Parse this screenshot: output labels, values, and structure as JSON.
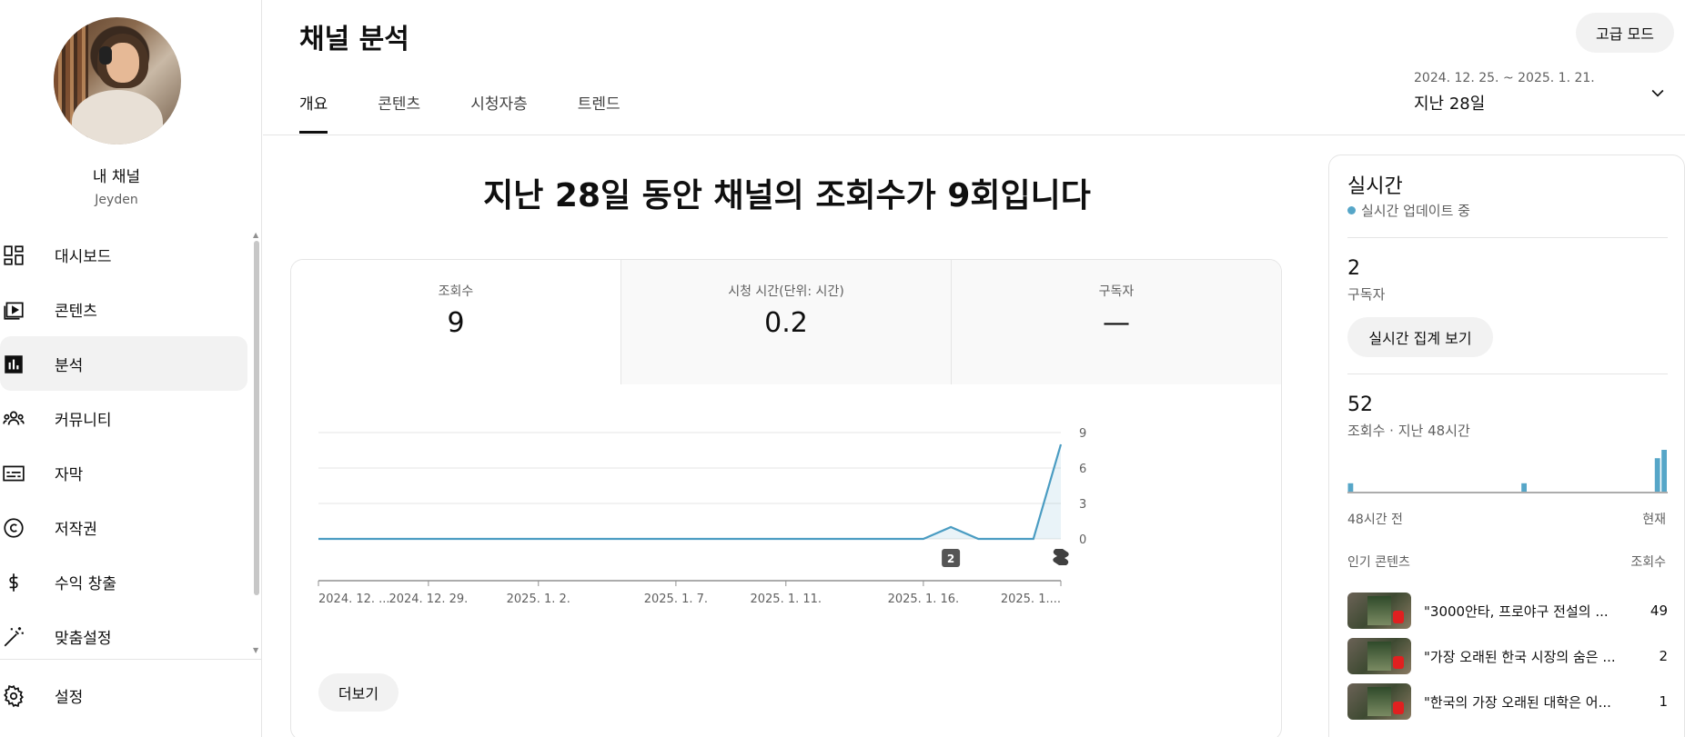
{
  "sidebar": {
    "channel_name": "내 채널",
    "channel_handle": "Jeyden",
    "items": [
      {
        "label": "대시보드",
        "icon": "dashboard-icon"
      },
      {
        "label": "콘텐츠",
        "icon": "content-icon"
      },
      {
        "label": "분석",
        "icon": "analytics-icon"
      },
      {
        "label": "커뮤니티",
        "icon": "community-icon"
      },
      {
        "label": "자막",
        "icon": "subtitles-icon"
      },
      {
        "label": "저작권",
        "icon": "copyright-icon"
      },
      {
        "label": "수익 창출",
        "icon": "monetization-icon"
      },
      {
        "label": "맞춤설정",
        "icon": "customization-icon"
      }
    ],
    "settings_label": "설정",
    "active_item": "분석"
  },
  "header": {
    "title": "채널 분석",
    "advanced_mode": "고급 모드",
    "tabs": [
      "개요",
      "콘텐츠",
      "시청자층",
      "트렌드"
    ],
    "active_tab": "개요",
    "date_range": "2024. 12. 25. ~ 2025. 1. 21.",
    "date_label": "지난 28일"
  },
  "main": {
    "headline": "지난 28일 동안 채널의 조회수가 9회입니다",
    "metrics": [
      {
        "label": "조회수",
        "value": "9"
      },
      {
        "label": "시청 시간(단위: 시간)",
        "value": "0.2"
      },
      {
        "label": "구독자",
        "value": "—"
      }
    ],
    "more_button": "더보기"
  },
  "chart_data": {
    "type": "line",
    "x": [
      "2024. 12. 25.",
      "2024. 12. 26.",
      "2024. 12. 27.",
      "2024. 12. 28.",
      "2024. 12. 29.",
      "2024. 12. 30.",
      "2024. 12. 31.",
      "2025. 1. 1.",
      "2025. 1. 2.",
      "2025. 1. 3.",
      "2025. 1. 4.",
      "2025. 1. 5.",
      "2025. 1. 6.",
      "2025. 1. 7.",
      "2025. 1. 8.",
      "2025. 1. 9.",
      "2025. 1. 10.",
      "2025. 1. 11.",
      "2025. 1. 12.",
      "2025. 1. 13.",
      "2025. 1. 14.",
      "2025. 1. 15.",
      "2025. 1. 16.",
      "2025. 1. 17.",
      "2025. 1. 18.",
      "2025. 1. 19.",
      "2025. 1. 20.",
      "2025. 1. 21."
    ],
    "values": [
      0,
      0,
      0,
      0,
      0,
      0,
      0,
      0,
      0,
      0,
      0,
      0,
      0,
      0,
      0,
      0,
      0,
      0,
      0,
      0,
      0,
      0,
      0,
      1,
      0,
      0,
      0,
      8
    ],
    "tick_labels": [
      {
        "label": "2024. 12. ...",
        "index": 0
      },
      {
        "label": "2024. 12. 29.",
        "index": 4
      },
      {
        "label": "2025. 1. 2.",
        "index": 8
      },
      {
        "label": "2025. 1. 7.",
        "index": 13
      },
      {
        "label": "2025. 1. 11.",
        "index": 17
      },
      {
        "label": "2025. 1. 16.",
        "index": 22
      },
      {
        "label": "2025. 1....",
        "index": 27
      }
    ],
    "y_ticks": [
      0,
      3,
      6,
      9
    ],
    "ylim": [
      0,
      9
    ],
    "markers": [
      {
        "index": 23,
        "label": "2"
      },
      {
        "index": 27,
        "label": "shorts-icon"
      }
    ],
    "grid": true,
    "line_color": "#4a9cc2"
  },
  "realtime": {
    "title": "실시간",
    "live_text": "실시간 업데이트 중",
    "subscribers": "2",
    "subscribers_label": "구독자",
    "realtime_button": "실시간 집계 보기",
    "views_48h": "52",
    "views_48h_label": "조회수 · 지난 48시간",
    "axis_start": "48시간 전",
    "axis_end": "현재",
    "bars_48h": [
      1,
      0,
      0,
      0,
      0,
      0,
      0,
      0,
      0,
      0,
      0,
      0,
      0,
      0,
      0,
      0,
      0,
      0,
      0,
      0,
      0,
      0,
      0,
      0,
      0,
      0,
      1,
      0,
      0,
      0,
      0,
      0,
      0,
      0,
      0,
      0,
      0,
      0,
      0,
      0,
      0,
      0,
      0,
      0,
      0,
      0,
      4,
      5
    ],
    "popular_header": "인기 콘텐츠",
    "popular_value_header": "조회수",
    "popular": [
      {
        "title": "\"3000안타, 프로야구 전설의 ...",
        "views": "49"
      },
      {
        "title": "\"가장 오래된 한국 시장의 숨은 ...",
        "views": "2"
      },
      {
        "title": "\"한국의 가장 오래된 대학은 어...",
        "views": "1"
      }
    ],
    "accent": "#56a6c8"
  }
}
